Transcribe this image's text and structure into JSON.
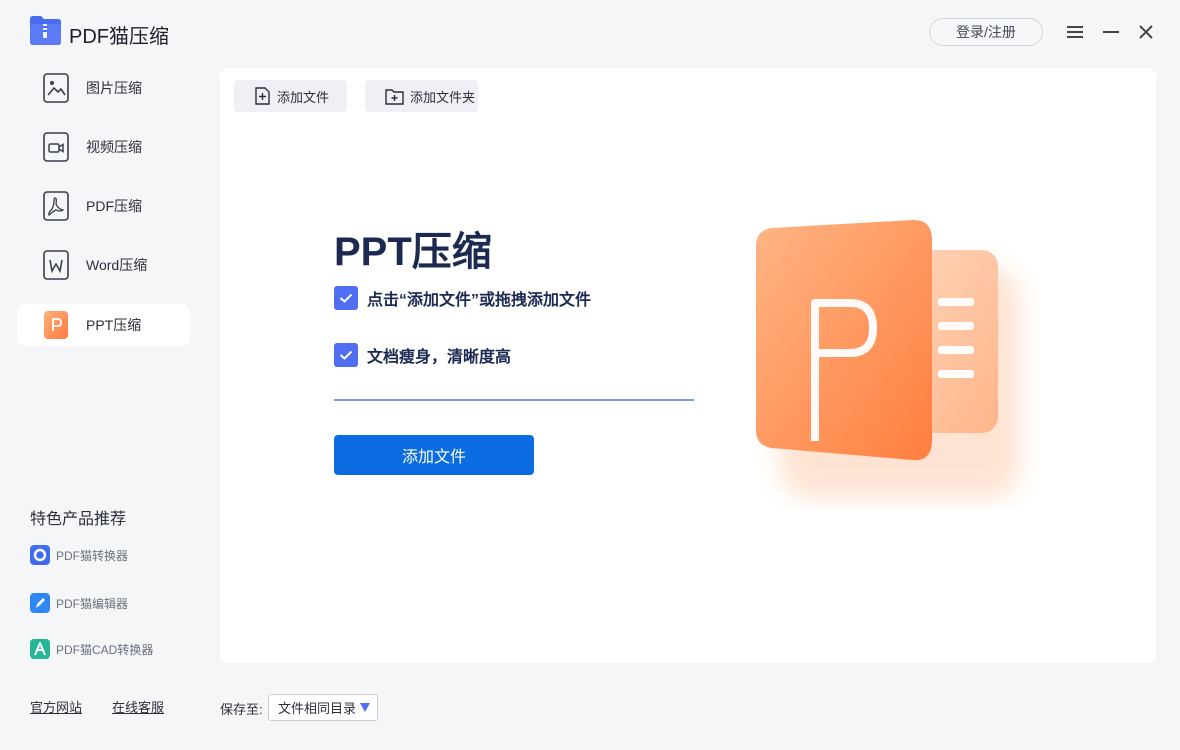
{
  "app": {
    "title": "PDF猫压缩",
    "login_label": "登录/注册"
  },
  "sidebar": {
    "items": [
      {
        "label": "图片压缩",
        "icon": "image-icon"
      },
      {
        "label": "视频压缩",
        "icon": "video-icon"
      },
      {
        "label": "PDF压缩",
        "icon": "pdf-icon"
      },
      {
        "label": "Word压缩",
        "icon": "word-icon"
      },
      {
        "label": "PPT压缩",
        "icon": "ppt-icon",
        "active": true
      }
    ]
  },
  "recommend": {
    "title": "特色产品推荐",
    "items": [
      {
        "label": "PDF猫转换器",
        "icon": "converter-icon",
        "color": "#3d6cf0"
      },
      {
        "label": "PDF猫编辑器",
        "icon": "editor-icon",
        "color": "#2f86f5"
      },
      {
        "label": "PDF猫CAD转换器",
        "icon": "cad-icon",
        "color": "#25b597"
      }
    ]
  },
  "footer": {
    "official_site": "官方网站",
    "online_service": "在线客服",
    "save_label": "保存至:",
    "save_value": "文件相同目录"
  },
  "toolbar": {
    "add_file": "添加文件",
    "add_folder": "添加文件夹"
  },
  "main": {
    "title": "PPT压缩",
    "checks": [
      "点击“添加文件”或拖拽添加文件",
      "文档瘦身，清晰度高"
    ],
    "add_button": "添加文件"
  },
  "colors": {
    "accent": "#0a6ce0",
    "checkbox": "#4f6ef2",
    "ppt_orange": "#ff8a4c"
  }
}
